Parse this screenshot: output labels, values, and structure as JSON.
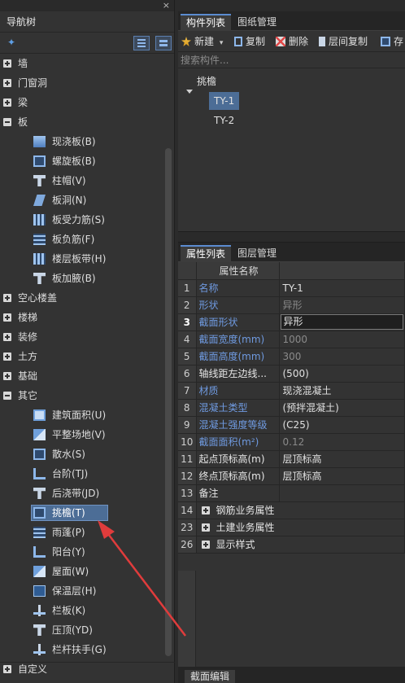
{
  "nav": {
    "title": "导航树",
    "close_glyph": "×",
    "categories_top": [
      {
        "label": "墙"
      },
      {
        "label": "门窗洞"
      },
      {
        "label": "梁"
      },
      {
        "label": "板"
      }
    ],
    "slab_items": [
      {
        "label": "现浇板(B)",
        "icon": "cast-slab-icon"
      },
      {
        "label": "螺旋板(B)",
        "icon": "spiral-slab-icon"
      },
      {
        "label": "柱帽(V)",
        "icon": "column-cap-icon"
      },
      {
        "label": "板洞(N)",
        "icon": "slab-hole-icon"
      },
      {
        "label": "板受力筋(S)",
        "icon": "slab-rebar-icon"
      },
      {
        "label": "板负筋(F)",
        "icon": "negative-rebar-icon"
      },
      {
        "label": "楼层板带(H)",
        "icon": "slab-strip-icon"
      },
      {
        "label": "板加腋(B)",
        "icon": "slab-haunch-icon"
      }
    ],
    "categories_mid": [
      {
        "label": "空心楼盖"
      },
      {
        "label": "楼梯"
      },
      {
        "label": "装修"
      },
      {
        "label": "土方"
      },
      {
        "label": "基础"
      },
      {
        "label": "其它"
      }
    ],
    "other_items": [
      {
        "label": "建筑面积(U)",
        "icon": "building-area-icon"
      },
      {
        "label": "平整场地(V)",
        "icon": "site-leveling-icon"
      },
      {
        "label": "散水(S)",
        "icon": "apron-icon"
      },
      {
        "label": "台阶(TJ)",
        "icon": "steps-icon"
      },
      {
        "label": "后浇带(JD)",
        "icon": "post-cast-strip-icon"
      },
      {
        "label": "挑檐(T)",
        "icon": "cornice-icon",
        "selected": true
      },
      {
        "label": "雨蓬(P)",
        "icon": "canopy-icon"
      },
      {
        "label": "阳台(Y)",
        "icon": "balcony-icon"
      },
      {
        "label": "屋面(W)",
        "icon": "roof-icon"
      },
      {
        "label": "保温层(H)",
        "icon": "insulation-icon"
      },
      {
        "label": "栏板(K)",
        "icon": "parapet-icon"
      },
      {
        "label": "压顶(YD)",
        "icon": "coping-icon"
      },
      {
        "label": "栏杆扶手(G)",
        "icon": "railing-icon"
      }
    ],
    "categories_bottom": [
      {
        "label": "自定义"
      }
    ]
  },
  "components": {
    "tabs": [
      "构件列表",
      "图纸管理"
    ],
    "toolbar": {
      "new_label": "新建",
      "new_dropdown_glyph": "▾",
      "copy_label": "复制",
      "delete_label": "删除",
      "floor_copy_label": "层间复制",
      "save_label": "存"
    },
    "search_placeholder": "搜索构件...",
    "tree": {
      "group": "挑檐",
      "items": [
        "TY-1",
        "TY-2"
      ]
    }
  },
  "properties": {
    "tabs": [
      "属性列表",
      "图层管理"
    ],
    "header": "属性名称",
    "rows": [
      {
        "num": "1",
        "name": "名称",
        "value": "TY-1",
        "style": "blue"
      },
      {
        "num": "2",
        "name": "形状",
        "value": "异形",
        "style": "blue",
        "value_style": "gray"
      },
      {
        "num": "3",
        "name": "截面形状",
        "value": "异形",
        "style": "blue",
        "current": true
      },
      {
        "num": "4",
        "name": "截面宽度(mm)",
        "value": "1000",
        "style": "blue",
        "value_style": "gray"
      },
      {
        "num": "5",
        "name": "截面高度(mm)",
        "value": "300",
        "style": "blue",
        "value_style": "gray"
      },
      {
        "num": "6",
        "name": "轴线距左边线...",
        "value": "(500)",
        "style": "white"
      },
      {
        "num": "7",
        "name": "材质",
        "value": "现浇混凝土",
        "style": "blue"
      },
      {
        "num": "8",
        "name": "混凝土类型",
        "value": "(预拌混凝土)",
        "style": "blue"
      },
      {
        "num": "9",
        "name": "混凝土强度等级",
        "value": "(C25)",
        "style": "blue"
      },
      {
        "num": "10",
        "name": "截面面积(m²)",
        "value": "0.12",
        "style": "blue",
        "value_style": "gray"
      },
      {
        "num": "11",
        "name": "起点顶标高(m)",
        "value": "层顶标高",
        "style": "white"
      },
      {
        "num": "12",
        "name": "终点顶标高(m)",
        "value": "层顶标高",
        "style": "white"
      },
      {
        "num": "13",
        "name": "备注",
        "value": "",
        "style": "white"
      }
    ],
    "groups": [
      {
        "num": "14",
        "label": "钢筋业务属性"
      },
      {
        "num": "23",
        "label": "土建业务属性"
      },
      {
        "num": "26",
        "label": "显示样式"
      }
    ]
  },
  "bottom_tab": "截面编辑",
  "colors": {
    "accent": "#5b8bd0",
    "selection": "#4c6d96",
    "property_name_blue": "#6f9ae0",
    "annotation_arrow": "#e03c3c"
  }
}
